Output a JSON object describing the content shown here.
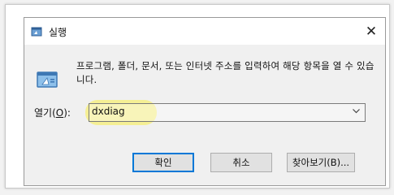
{
  "dialog": {
    "title": "실행",
    "description": "프로그램, 폴더, 문서, 또는 인터넷 주소를 입력하여 해당 항목을 열 수 있습니다.",
    "open_label_prefix": "열기(",
    "open_label_key": "O",
    "open_label_suffix": "):",
    "input_value": "dxdiag",
    "buttons": {
      "ok": "확인",
      "cancel": "취소",
      "browse": "찾아보기(B)..."
    }
  },
  "colors": {
    "highlight": "#f6ef84",
    "primary_border": "#0078d7"
  }
}
